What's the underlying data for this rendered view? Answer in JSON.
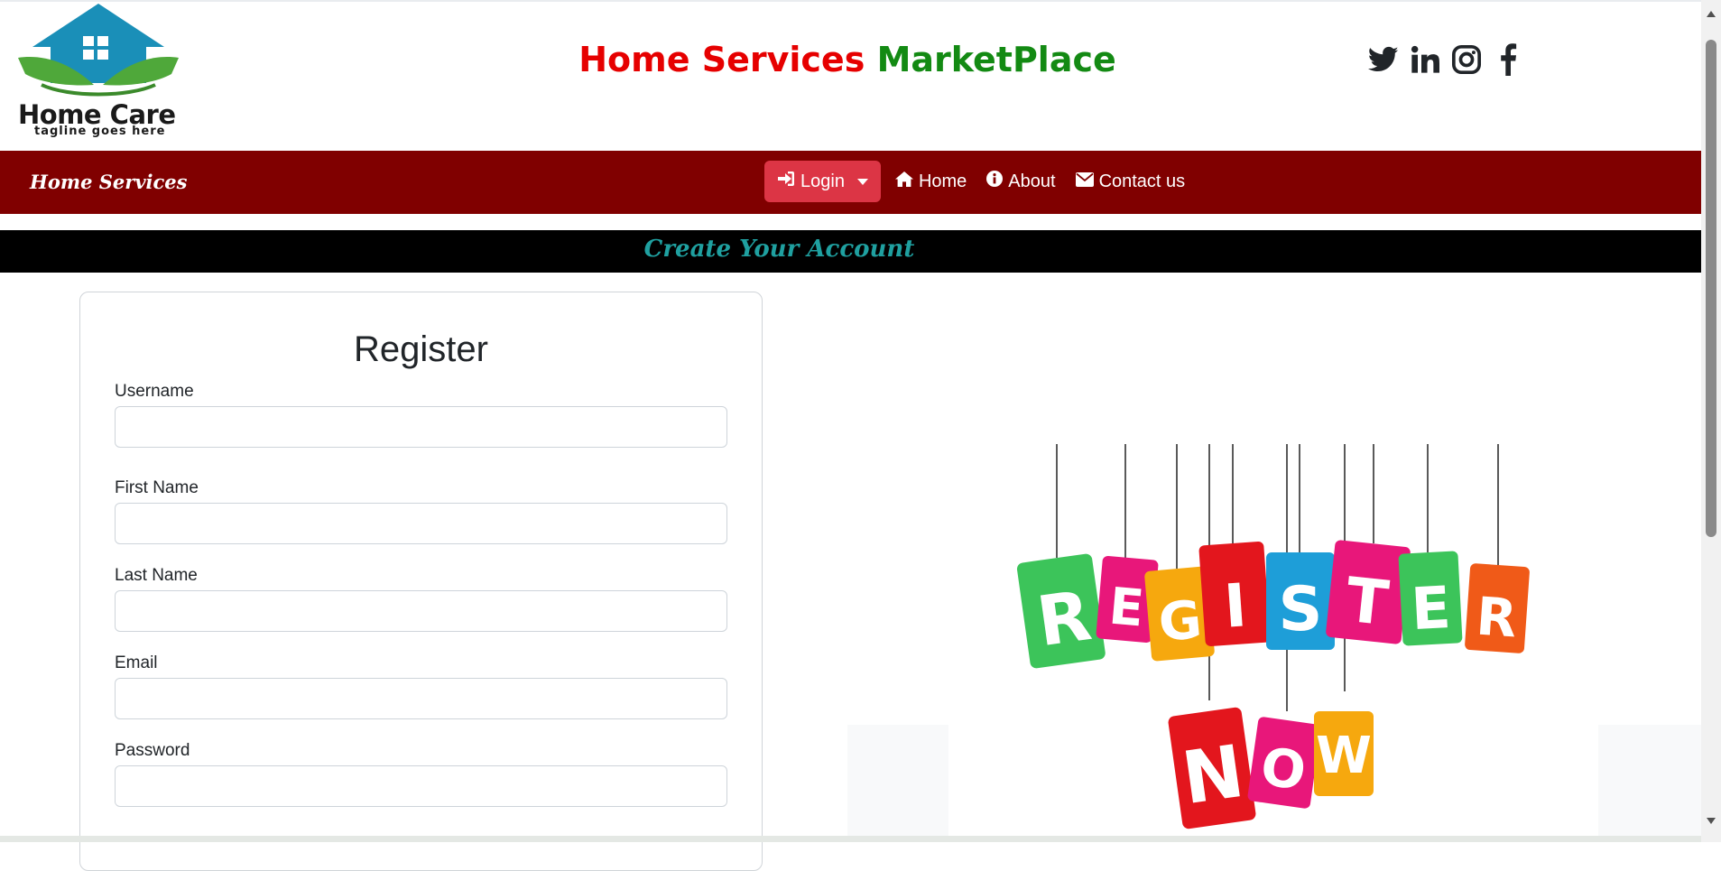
{
  "header": {
    "logo_wordmark": "Home Care",
    "logo_tagline": "tagline goes here",
    "title_part1": "Home Services",
    "title_part2": "MarketPlace",
    "social_icons": [
      "twitter-icon",
      "linkedin-icon",
      "instagram-icon",
      "facebook-icon"
    ]
  },
  "navbar": {
    "brand": "Home Services",
    "login_label": "Login",
    "home_label": "Home",
    "about_label": "About",
    "contact_label": "Contact us"
  },
  "banner": {
    "text": "Create Your Account"
  },
  "form": {
    "title": "Register",
    "fields": [
      {
        "label": "Username",
        "value": ""
      },
      {
        "label": "First Name",
        "value": ""
      },
      {
        "label": "Last Name",
        "value": ""
      },
      {
        "label": "Email",
        "value": ""
      },
      {
        "label": "Password",
        "value": ""
      }
    ]
  },
  "illustration": {
    "letters_row1": [
      "R",
      "E",
      "G",
      "I",
      "S",
      "T",
      "E",
      "R"
    ],
    "letters_row2": [
      "N",
      "O",
      "W"
    ]
  },
  "colors": {
    "navbar_bg": "#800000",
    "login_button": "#dc3545",
    "title_red": "#e60000",
    "title_green": "#138a13",
    "banner_text": "#1fa0a0"
  }
}
